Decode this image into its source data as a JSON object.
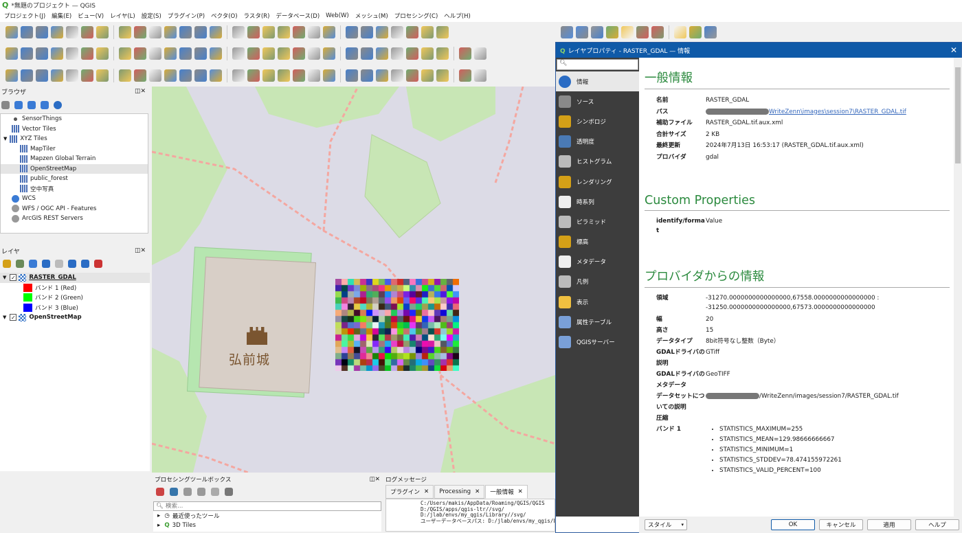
{
  "window": {
    "title": "*無題のプロジェクト — QGIS"
  },
  "menu": [
    "プロジェクト(J)",
    "編集(E)",
    "ビュー(V)",
    "レイヤ(L)",
    "設定(S)",
    "プラグイン(P)",
    "ベクタ(O)",
    "ラスタ(R)",
    "データベース(D)",
    "Web(W)",
    "メッシュ(M)",
    "プロセシング(C)",
    "ヘルプ(H)"
  ],
  "browser": {
    "title": "ブラウザ",
    "items": [
      {
        "label": "SensorThings",
        "indent": 0
      },
      {
        "label": "Vector Tiles",
        "indent": 0
      },
      {
        "label": "XYZ Tiles",
        "indent": 0,
        "expanded": true
      },
      {
        "label": "MapTiler",
        "indent": 1
      },
      {
        "label": "Mapzen Global Terrain",
        "indent": 1
      },
      {
        "label": "OpenStreetMap",
        "indent": 1,
        "selected": true
      },
      {
        "label": "public_forest",
        "indent": 1
      },
      {
        "label": "空中写真",
        "indent": 1
      },
      {
        "label": "WCS",
        "indent": 0
      },
      {
        "label": "WFS / OGC API - Features",
        "indent": 0
      },
      {
        "label": "ArcGIS REST Servers",
        "indent": 0
      }
    ]
  },
  "layers": {
    "title": "レイヤ",
    "items": [
      {
        "label": "RASTER_GDAL",
        "type": "layer",
        "underline": true
      },
      {
        "label": "バンド 1 (Red)",
        "type": "band",
        "color": "#ff0000"
      },
      {
        "label": "バンド 2 (Green)",
        "type": "band",
        "color": "#00ff00"
      },
      {
        "label": "バンド 3 (Blue)",
        "type": "band",
        "color": "#0000ff"
      },
      {
        "label": "OpenStreetMap",
        "type": "layer"
      }
    ]
  },
  "map": {
    "castle_label": "弘前城"
  },
  "processing": {
    "title": "プロセシングツールボックス",
    "search_placeholder": "検索...",
    "items": [
      "最近使ったツール",
      "3D Tiles"
    ]
  },
  "log": {
    "title": "ログメッセージ",
    "tabs": [
      "プラグイン",
      "Processing",
      "一般情報"
    ],
    "active_tab": 2,
    "lines": [
      "C:/Users/makis/AppData/Roaming/QGIS/QGIS",
      "D:/QGIS/apps/qgis-ltr//svg/",
      "D:/jlab/envs/my_qgis/Library//svg/",
      "ユーザーデータベースパス: D:/jlab/envs/my_qgis/Li"
    ]
  },
  "dialog": {
    "title": "レイヤプロパティ - RASTER_GDAL — 情報",
    "sidebar": [
      "情報",
      "ソース",
      "シンボロジ",
      "透明度",
      "ヒストグラム",
      "レンダリング",
      "時系列",
      "ピラミッド",
      "標高",
      "メタデータ",
      "凡例",
      "表示",
      "属性テーブル",
      "QGISサーバー"
    ],
    "sidebar_selected": 0,
    "general": {
      "heading": "一般情報",
      "rows": [
        {
          "k": "名前",
          "v": "RASTER_GDAL"
        },
        {
          "k": "パス",
          "v": "WriteZenn\\images\\session7\\RASTER_GDAL.tif",
          "link": true,
          "redacted": true
        },
        {
          "k": "補助ファイル",
          "v": "RASTER_GDAL.tif.aux.xml"
        },
        {
          "k": "合計サイズ",
          "v": "2 KB"
        },
        {
          "k": "最終更新",
          "v": "2024年7月13日 16:53:17 (RASTER_GDAL.tif.aux.xml)"
        },
        {
          "k": "プロバイダ",
          "v": "gdal"
        }
      ]
    },
    "custom": {
      "heading": "Custom Properties",
      "key": "identify/format",
      "value": "Value"
    },
    "provider": {
      "heading": "プロバイダからの情報",
      "extent_label": "領域",
      "extent": [
        "-31270.0000000000000000,67558.0000000000000000 :",
        "-31250.0000000000000000,67573.0000000000000000"
      ],
      "rows": [
        {
          "k": "幅",
          "v": "20"
        },
        {
          "k": "高さ",
          "v": "15"
        },
        {
          "k": "データタイプ",
          "v": "8bit符号なし整数（Byte）"
        },
        {
          "k": "GDALドライバの説明",
          "v": "GTiff"
        },
        {
          "k": "GDALドライバのメタデータ",
          "v": "GeoTIFF"
        },
        {
          "k": "データセットについての説明",
          "v": "/WriteZenn/images/session7/RASTER_GDAL.tif",
          "redacted": true
        },
        {
          "k": "圧縮",
          "v": ""
        }
      ],
      "band_label": "バンド 1",
      "band_stats": [
        "STATISTICS_MAXIMUM=255",
        "STATISTICS_MEAN=129.98666666667",
        "STATISTICS_MINIMUM=1",
        "STATISTICS_STDDEV=78.474155972261",
        "STATISTICS_VALID_PERCENT=100"
      ]
    },
    "buttons": {
      "style": "スタイル",
      "ok": "OK",
      "cancel": "キャンセル",
      "apply": "適用",
      "help": "ヘルプ"
    }
  },
  "colors": {
    "map_bg": "#dcdbe6",
    "park_green": "#c8e6b5",
    "building": "#d8cfc7",
    "heading_green": "#2b8a3e",
    "title_blue": "#0f5aa8"
  }
}
